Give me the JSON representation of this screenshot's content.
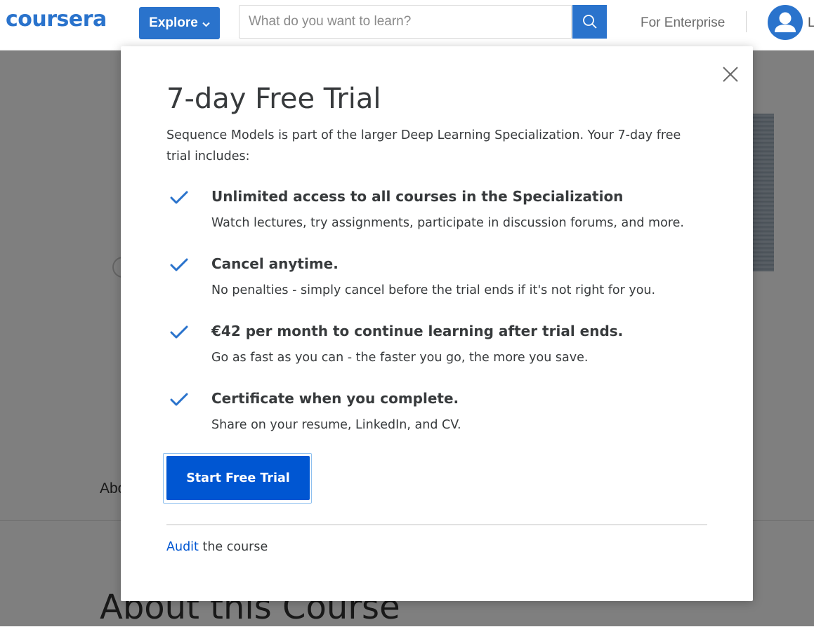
{
  "header": {
    "logo_text": "coursera",
    "explore_label": "Explore",
    "search_placeholder": "What do you want to learn?",
    "enterprise_label": "For Enterprise",
    "login_partial": "L"
  },
  "background": {
    "about_tab_partial": "Abo",
    "about_heading": "About this Course"
  },
  "modal": {
    "title": "7-day Free Trial",
    "intro": "Sequence Models is part of the larger Deep Learning Specialization. Your 7-day free trial includes:",
    "benefits": [
      {
        "title": "Unlimited access to all courses in the Specialization",
        "description": "Watch lectures, try assignments, participate in discussion forums, and more."
      },
      {
        "title": "Cancel anytime.",
        "description": "No penalties - simply cancel before the trial ends if it's not right for you."
      },
      {
        "title": "€42 per month to continue learning after trial ends.",
        "description": "Go as fast as you can - the faster you go, the more you save."
      },
      {
        "title": "Certificate when you complete.",
        "description": "Share on your resume, LinkedIn, and CV."
      }
    ],
    "start_button_label": "Start Free Trial",
    "audit_link_label": "Audit",
    "audit_suffix": " the course"
  },
  "colors": {
    "brand_blue": "#2a73cc",
    "cta_blue": "#0056d2",
    "check_blue": "#2a73cc"
  },
  "icons": {
    "search": "search-icon",
    "close": "close-icon",
    "check": "check-icon",
    "chevron": "chevron-down-icon",
    "avatar": "user-avatar-icon"
  }
}
